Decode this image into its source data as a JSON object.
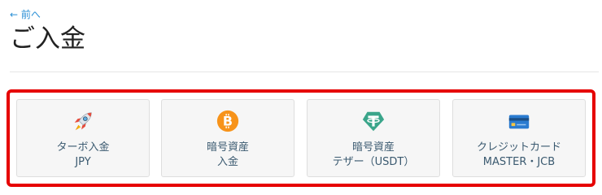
{
  "nav": {
    "back_label": "← 前へ"
  },
  "page": {
    "title": "ご入金"
  },
  "highlight_color": "#e60000",
  "options": [
    {
      "icon": "rocket-icon",
      "line1": "ターボ入金",
      "line2": "JPY"
    },
    {
      "icon": "bitcoin-icon",
      "line1": "暗号資産",
      "line2": "入金",
      "icon_color": "#f7931a"
    },
    {
      "icon": "tether-icon",
      "line1": "暗号資産",
      "line2": "テザー（USDT）",
      "icon_color": "#3aa58a"
    },
    {
      "icon": "credit-card-icon",
      "line1": "クレジットカード",
      "line2": "MASTER・JCB",
      "icon_color": "#2a7bd0"
    }
  ]
}
